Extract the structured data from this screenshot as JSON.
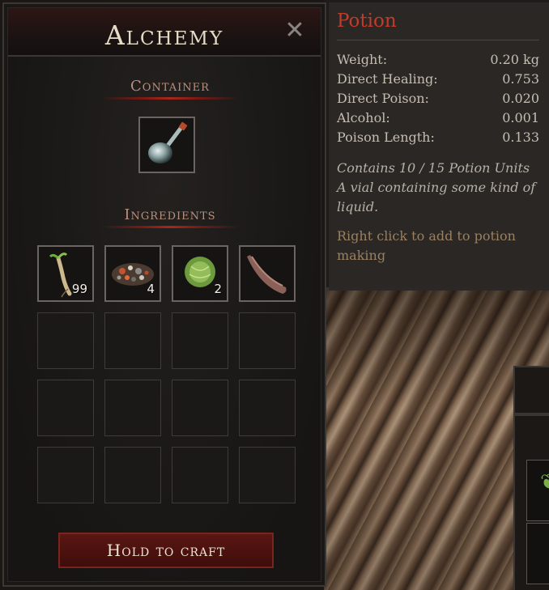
{
  "alchemy": {
    "title": "Alchemy",
    "close_icon": "close-icon",
    "container_label": "Container",
    "ingredients_label": "Ingredients",
    "container_item": {
      "icon": "potion-vial-icon"
    },
    "ingredients": [
      {
        "icon": "root-sprout-icon",
        "qty": "99"
      },
      {
        "icon": "crushed-minerals-icon",
        "qty": "4"
      },
      {
        "icon": "cabbage-icon",
        "qty": "2"
      },
      {
        "icon": "horn-icon",
        "qty": ""
      }
    ],
    "empty_slots": 12,
    "craft_button": "Hold to craft"
  },
  "tooltip": {
    "title": "Potion",
    "stats": [
      {
        "label": "Weight:",
        "value": "0.20 kg"
      },
      {
        "label": "Direct Healing:",
        "value": "0.753"
      },
      {
        "label": "Direct Poison:",
        "value": "0.020"
      },
      {
        "label": "Alcohol:",
        "value": "0.001"
      },
      {
        "label": "Poison Length:",
        "value": "0.133"
      }
    ],
    "units_text": "Contains 10 / 15 Potion Units",
    "description": "A vial containing some kind of liquid.",
    "hint": "Right click to add to potion making"
  },
  "colors": {
    "accent_red": "#c23b2b",
    "craft_button_bg": "#4a110e",
    "hint_text": "#9a8060"
  }
}
